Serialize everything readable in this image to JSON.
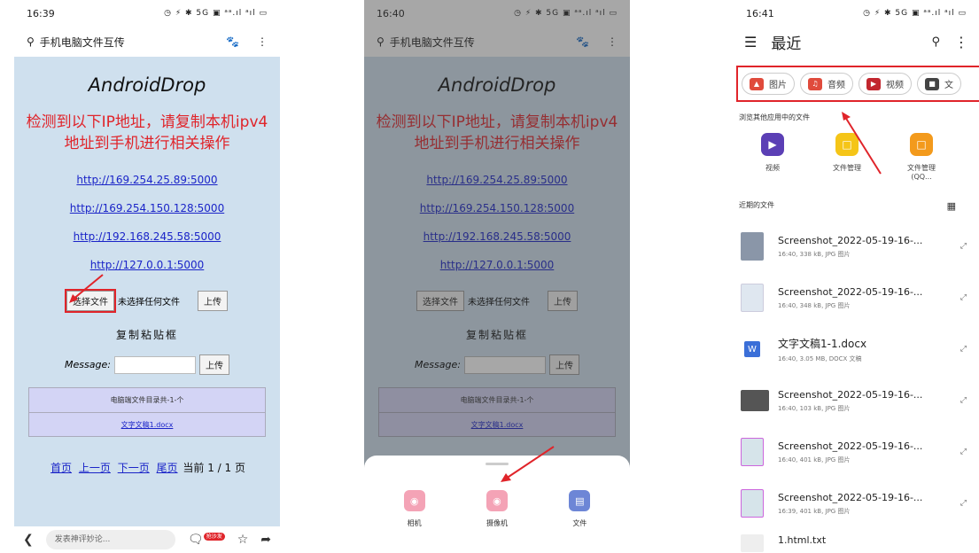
{
  "screen1": {
    "time": "16:39",
    "status_icons": "◷ ⚡ ✱ 5G ▣ ᵃᵃ.ıl ᵃıl ▭",
    "search_title": "手机电脑文件互传",
    "brand": "AndroidDrop",
    "notice": "检测到以下IP地址，请复制本机ipv4地址到手机进行相关操作",
    "ips": [
      "http://169.254.25.89:5000",
      "http://169.254.150.128:5000",
      "http://192.168.245.58:5000",
      "http://127.0.0.1:5000"
    ],
    "choose_file": "选择文件",
    "no_file": "未选择任何文件",
    "upload": "上传",
    "clipboard_title": "复制粘贴框",
    "message_label": "Message:",
    "file_list_header": "电脑端文件目录共-1-个",
    "file_link": "文字文稿1.docx",
    "pager": {
      "first": "首页",
      "prev": "上一页",
      "next": "下一页",
      "last": "尾页",
      "current": "当前 1 / 1 页"
    },
    "comment_placeholder": "发表神评妙论...",
    "badge": "抢沙发"
  },
  "screen2": {
    "time": "16:40",
    "sheet_items": [
      "相机",
      "摄像机",
      "文件"
    ]
  },
  "screen3": {
    "time": "16:41",
    "title": "最近",
    "chips": [
      "图片",
      "音频",
      "视频",
      "文"
    ],
    "browse_label": "浏览其他应用中的文件",
    "apps": [
      "视频",
      "文件管理",
      "文件管理(QQ..."
    ],
    "recent_label": "近期的文件",
    "files": [
      {
        "name": "Screenshot_2022-05-19-16-...",
        "meta": "16:40, 338 kB, JPG 图片"
      },
      {
        "name": "Screenshot_2022-05-19-16-...",
        "meta": "16:40, 348 kB, JPG 图片"
      },
      {
        "name": "文字文稿1-1.docx",
        "meta": "16:40, 3.05 MB, DOCX 文稿"
      },
      {
        "name": "Screenshot_2022-05-19-16-...",
        "meta": "16:40, 103 kB, JPG 图片"
      },
      {
        "name": "Screenshot_2022-05-19-16-...",
        "meta": "16:40, 401 kB, JPG 图片"
      },
      {
        "name": "Screenshot_2022-05-19-16-...",
        "meta": "16:39, 401 kB, JPG 图片"
      },
      {
        "name": "1.html.txt",
        "meta": ""
      }
    ]
  },
  "colors": {
    "page_bg": "#cfe0ee",
    "notice_red": "#e0242a",
    "link_blue": "#1a24c8",
    "table_purple": "#d3d4f5"
  }
}
